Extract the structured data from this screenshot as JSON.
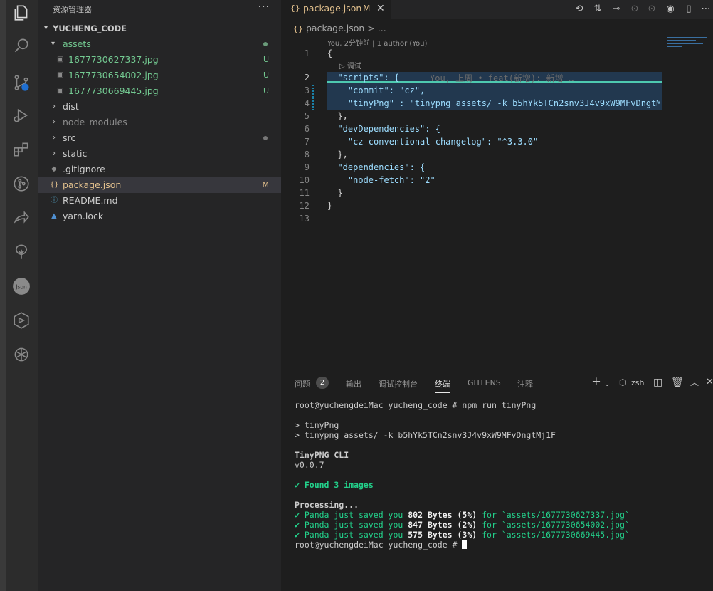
{
  "sidebar": {
    "title": "资源管理器",
    "more": "···",
    "root": "YUCHENG_CODE",
    "items": [
      {
        "name": "assets",
        "type": "folder-open",
        "status": "dot",
        "color": "#73c991"
      },
      {
        "name": "1677730627337.jpg",
        "type": "image",
        "status": "U",
        "color": "#73c991"
      },
      {
        "name": "1677730654002.jpg",
        "type": "image",
        "status": "U",
        "color": "#73c991"
      },
      {
        "name": "1677730669445.jpg",
        "type": "image",
        "status": "U",
        "color": "#73c991"
      },
      {
        "name": "dist",
        "type": "folder",
        "status": "",
        "color": "#cccccc"
      },
      {
        "name": "node_modules",
        "type": "folder",
        "status": "",
        "color": "#8b8b8b"
      },
      {
        "name": "src",
        "type": "folder",
        "status": "dot",
        "color": "#cccccc"
      },
      {
        "name": "static",
        "type": "folder",
        "status": "",
        "color": "#cccccc"
      },
      {
        "name": ".gitignore",
        "type": "git",
        "status": "",
        "color": "#cccccc"
      },
      {
        "name": "package.json",
        "type": "json",
        "status": "M",
        "color": "#e2c08d"
      },
      {
        "name": "README.md",
        "type": "info",
        "status": "",
        "color": "#cccccc"
      },
      {
        "name": "yarn.lock",
        "type": "yarn",
        "status": "",
        "color": "#cccccc"
      }
    ]
  },
  "editor": {
    "tab": {
      "icon": "{}",
      "label": "package.json",
      "modified": "M",
      "close": "✕"
    },
    "breadcrumb": {
      "icon": "{}",
      "file": "package.json",
      "sep": ">",
      "rest": "..."
    },
    "blame": "You, 2分钟前 | 1 author (You)",
    "codelens": "调试",
    "ghost": "You, 上周 • feat(新增): 新增 …",
    "lines": [
      {
        "n": "1",
        "text": "{"
      },
      {
        "n": "2",
        "text": "  \"scripts\": {"
      },
      {
        "n": "3",
        "text": "    \"commit\": \"cz\","
      },
      {
        "n": "4",
        "text": "    \"tinyPng\" : \"tinypng assets/ -k b5hYk5TCn2snv3J4v9xW9MFvDngtM"
      },
      {
        "n": "5",
        "text": "  },"
      },
      {
        "n": "6",
        "text": "  \"devDependencies\": {"
      },
      {
        "n": "7",
        "text": "    \"cz-conventional-changelog\": \"^3.3.0\""
      },
      {
        "n": "8",
        "text": "  },"
      },
      {
        "n": "9",
        "text": "  \"dependencies\": {"
      },
      {
        "n": "10",
        "text": "    \"node-fetch\": \"2\""
      },
      {
        "n": "11",
        "text": "  }"
      },
      {
        "n": "12",
        "text": "}"
      },
      {
        "n": "13",
        "text": ""
      }
    ]
  },
  "panel": {
    "tabs": {
      "problems": "问题",
      "problems_count": "2",
      "output": "输出",
      "debug": "调试控制台",
      "terminal": "终端",
      "gitlens": "GITLENS",
      "comments": "注释"
    },
    "shell": "zsh",
    "terminal": {
      "l1": "root@yuchengdeiMac yucheng_code # npm run tinyPng",
      "l2": "> tinyPng",
      "l3": "> tinypng assets/ -k b5hYk5TCn2snv3J4v9xW9MFvDngtMj1F",
      "cli_title": "TinyPNG CLI",
      "version": "v0.0.7",
      "found": "✔ Found 3 images",
      "processing": "Processing...",
      "saved": [
        {
          "prefix": "✔ Panda just saved you ",
          "amount": "802 Bytes (5%)",
          "suffix": " for `assets/1677730627337.jpg`"
        },
        {
          "prefix": "✔ Panda just saved you ",
          "amount": "847 Bytes (2%)",
          "suffix": " for `assets/1677730654002.jpg`"
        },
        {
          "prefix": "✔ Panda just saved you ",
          "amount": "575 Bytes (3%)",
          "suffix": " for `assets/1677730669445.jpg`"
        }
      ],
      "prompt": "root@yuchengdeiMac yucheng_code # "
    }
  }
}
